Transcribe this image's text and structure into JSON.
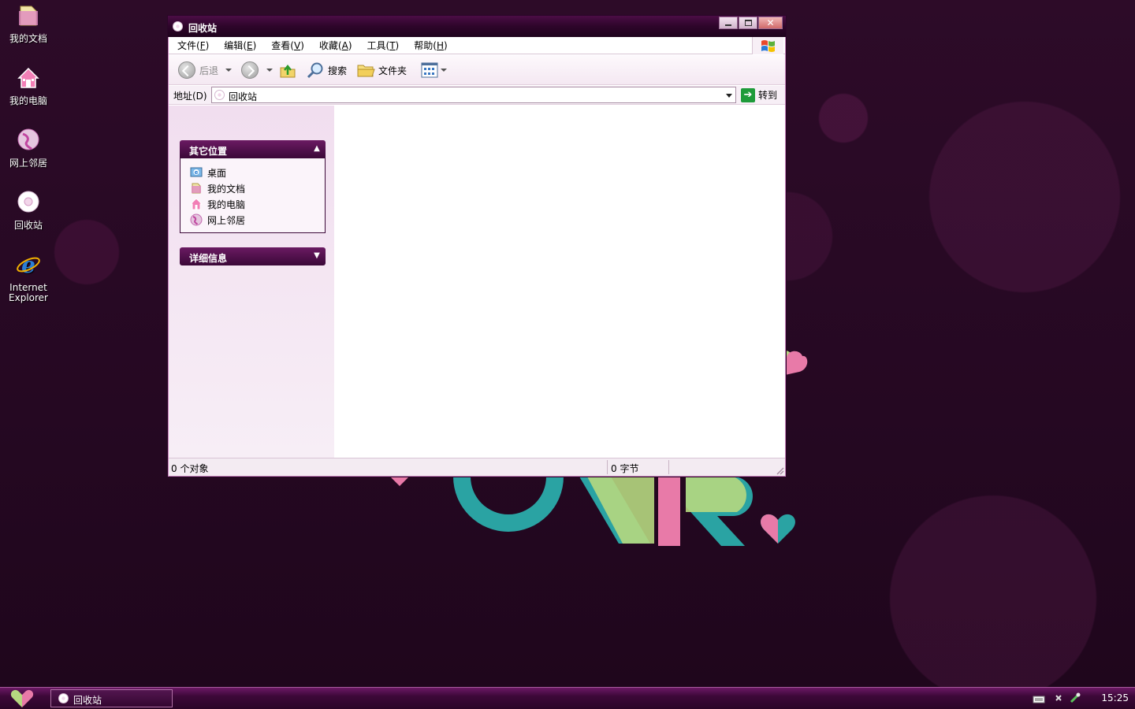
{
  "desktop": {
    "icons": [
      {
        "label": "我的文档"
      },
      {
        "label": "我的电脑"
      },
      {
        "label": "网上邻居"
      },
      {
        "label": "回收站"
      },
      {
        "label": "Internet Explorer"
      }
    ]
  },
  "window": {
    "title": "回收站",
    "menu": [
      {
        "label": "文件",
        "accel": "F"
      },
      {
        "label": "编辑",
        "accel": "E"
      },
      {
        "label": "查看",
        "accel": "V"
      },
      {
        "label": "收藏",
        "accel": "A"
      },
      {
        "label": "工具",
        "accel": "T"
      },
      {
        "label": "帮助",
        "accel": "H"
      }
    ],
    "toolbar": {
      "back": "后退",
      "search": "搜索",
      "folders": "文件夹"
    },
    "address": {
      "label": "地址(D)",
      "value": "回收站",
      "go": "转到"
    },
    "panels": {
      "other_places": {
        "title": "其它位置",
        "items": [
          "桌面",
          "我的文档",
          "我的电脑",
          "网上邻居"
        ]
      },
      "details": {
        "title": "详细信息"
      }
    },
    "status": {
      "objects": "0 个对象",
      "size": "0 字节"
    }
  },
  "taskbar": {
    "task_label": "回收站",
    "clock": "15:25"
  },
  "colors": {
    "titlebar": "#3b0838",
    "taskbar": "#3c0838",
    "desktop": "#2a0a26"
  }
}
